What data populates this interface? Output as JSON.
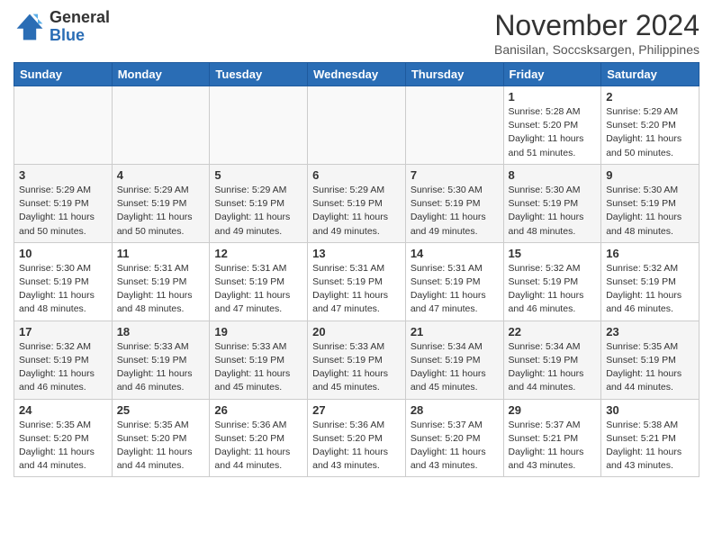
{
  "header": {
    "logo_general": "General",
    "logo_blue": "Blue",
    "month_title": "November 2024",
    "subtitle": "Banisilan, Soccsksargen, Philippines"
  },
  "weekdays": [
    "Sunday",
    "Monday",
    "Tuesday",
    "Wednesday",
    "Thursday",
    "Friday",
    "Saturday"
  ],
  "weeks": [
    [
      {
        "day": "",
        "info": ""
      },
      {
        "day": "",
        "info": ""
      },
      {
        "day": "",
        "info": ""
      },
      {
        "day": "",
        "info": ""
      },
      {
        "day": "",
        "info": ""
      },
      {
        "day": "1",
        "info": "Sunrise: 5:28 AM\nSunset: 5:20 PM\nDaylight: 11 hours and 51 minutes."
      },
      {
        "day": "2",
        "info": "Sunrise: 5:29 AM\nSunset: 5:20 PM\nDaylight: 11 hours and 50 minutes."
      }
    ],
    [
      {
        "day": "3",
        "info": "Sunrise: 5:29 AM\nSunset: 5:19 PM\nDaylight: 11 hours and 50 minutes."
      },
      {
        "day": "4",
        "info": "Sunrise: 5:29 AM\nSunset: 5:19 PM\nDaylight: 11 hours and 50 minutes."
      },
      {
        "day": "5",
        "info": "Sunrise: 5:29 AM\nSunset: 5:19 PM\nDaylight: 11 hours and 49 minutes."
      },
      {
        "day": "6",
        "info": "Sunrise: 5:29 AM\nSunset: 5:19 PM\nDaylight: 11 hours and 49 minutes."
      },
      {
        "day": "7",
        "info": "Sunrise: 5:30 AM\nSunset: 5:19 PM\nDaylight: 11 hours and 49 minutes."
      },
      {
        "day": "8",
        "info": "Sunrise: 5:30 AM\nSunset: 5:19 PM\nDaylight: 11 hours and 48 minutes."
      },
      {
        "day": "9",
        "info": "Sunrise: 5:30 AM\nSunset: 5:19 PM\nDaylight: 11 hours and 48 minutes."
      }
    ],
    [
      {
        "day": "10",
        "info": "Sunrise: 5:30 AM\nSunset: 5:19 PM\nDaylight: 11 hours and 48 minutes."
      },
      {
        "day": "11",
        "info": "Sunrise: 5:31 AM\nSunset: 5:19 PM\nDaylight: 11 hours and 48 minutes."
      },
      {
        "day": "12",
        "info": "Sunrise: 5:31 AM\nSunset: 5:19 PM\nDaylight: 11 hours and 47 minutes."
      },
      {
        "day": "13",
        "info": "Sunrise: 5:31 AM\nSunset: 5:19 PM\nDaylight: 11 hours and 47 minutes."
      },
      {
        "day": "14",
        "info": "Sunrise: 5:31 AM\nSunset: 5:19 PM\nDaylight: 11 hours and 47 minutes."
      },
      {
        "day": "15",
        "info": "Sunrise: 5:32 AM\nSunset: 5:19 PM\nDaylight: 11 hours and 46 minutes."
      },
      {
        "day": "16",
        "info": "Sunrise: 5:32 AM\nSunset: 5:19 PM\nDaylight: 11 hours and 46 minutes."
      }
    ],
    [
      {
        "day": "17",
        "info": "Sunrise: 5:32 AM\nSunset: 5:19 PM\nDaylight: 11 hours and 46 minutes."
      },
      {
        "day": "18",
        "info": "Sunrise: 5:33 AM\nSunset: 5:19 PM\nDaylight: 11 hours and 46 minutes."
      },
      {
        "day": "19",
        "info": "Sunrise: 5:33 AM\nSunset: 5:19 PM\nDaylight: 11 hours and 45 minutes."
      },
      {
        "day": "20",
        "info": "Sunrise: 5:33 AM\nSunset: 5:19 PM\nDaylight: 11 hours and 45 minutes."
      },
      {
        "day": "21",
        "info": "Sunrise: 5:34 AM\nSunset: 5:19 PM\nDaylight: 11 hours and 45 minutes."
      },
      {
        "day": "22",
        "info": "Sunrise: 5:34 AM\nSunset: 5:19 PM\nDaylight: 11 hours and 44 minutes."
      },
      {
        "day": "23",
        "info": "Sunrise: 5:35 AM\nSunset: 5:19 PM\nDaylight: 11 hours and 44 minutes."
      }
    ],
    [
      {
        "day": "24",
        "info": "Sunrise: 5:35 AM\nSunset: 5:20 PM\nDaylight: 11 hours and 44 minutes."
      },
      {
        "day": "25",
        "info": "Sunrise: 5:35 AM\nSunset: 5:20 PM\nDaylight: 11 hours and 44 minutes."
      },
      {
        "day": "26",
        "info": "Sunrise: 5:36 AM\nSunset: 5:20 PM\nDaylight: 11 hours and 44 minutes."
      },
      {
        "day": "27",
        "info": "Sunrise: 5:36 AM\nSunset: 5:20 PM\nDaylight: 11 hours and 43 minutes."
      },
      {
        "day": "28",
        "info": "Sunrise: 5:37 AM\nSunset: 5:20 PM\nDaylight: 11 hours and 43 minutes."
      },
      {
        "day": "29",
        "info": "Sunrise: 5:37 AM\nSunset: 5:21 PM\nDaylight: 11 hours and 43 minutes."
      },
      {
        "day": "30",
        "info": "Sunrise: 5:38 AM\nSunset: 5:21 PM\nDaylight: 11 hours and 43 minutes."
      }
    ]
  ]
}
